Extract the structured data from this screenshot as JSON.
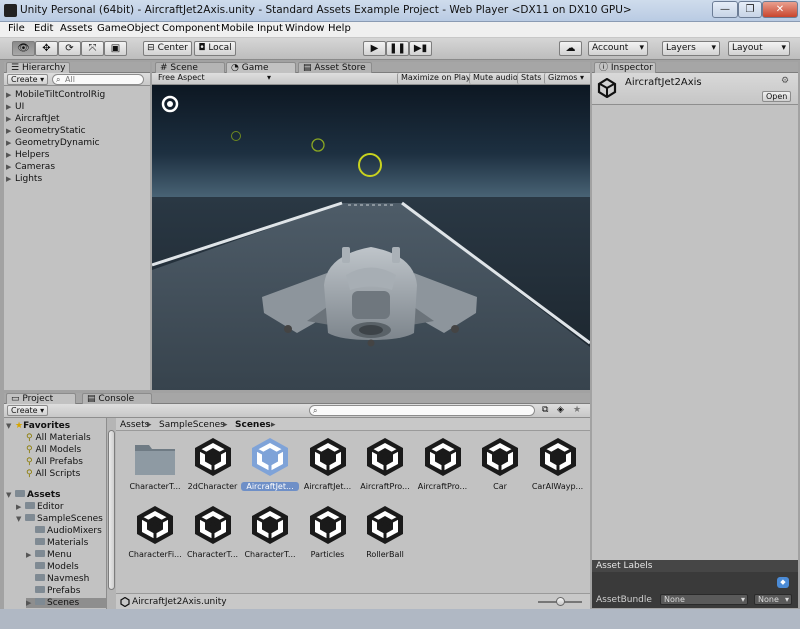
{
  "window": {
    "title": "Unity Personal (64bit) - AircraftJet2Axis.unity - Standard Assets Example Project - Web Player <DX11 on DX10 GPU>",
    "minimize": "—",
    "maximize": "❐",
    "close": "✕"
  },
  "menu": [
    "File",
    "Edit",
    "Assets",
    "GameObject",
    "Component",
    "Mobile Input",
    "Window",
    "Help"
  ],
  "toolbar": {
    "center_label": "Center",
    "local_label": "Local",
    "account_label": "Account",
    "layers_label": "Layers",
    "layout_label": "Layout"
  },
  "hierarchy": {
    "tab": "Hierarchy",
    "create": "Create",
    "search_placeholder": "All",
    "items": [
      "MobileTiltControlRig",
      "UI",
      "AircraftJet",
      "GeometryStatic",
      "GeometryDynamic",
      "Helpers",
      "Cameras",
      "Lights"
    ]
  },
  "center_tabs": {
    "scene": "Scene",
    "game": "Game",
    "asset_store": "Asset Store"
  },
  "game": {
    "aspect": "Free Aspect",
    "maximize_on_play": "Maximize on Play",
    "mute_audio": "Mute audio",
    "stats": "Stats",
    "gizmos": "Gizmos"
  },
  "inspector": {
    "tab": "Inspector",
    "object_name": "AircraftJet2Axis",
    "open_button": "Open",
    "asset_labels": "Asset Labels",
    "asset_bundle": "AssetBundle",
    "bundle_value": "None",
    "variant_value": "None"
  },
  "project": {
    "tab_project": "Project",
    "tab_console": "Console",
    "create": "Create",
    "breadcrumb": [
      "Assets",
      "SampleScenes",
      "Scenes"
    ],
    "favorites": {
      "label": "Favorites",
      "items": [
        "All Materials",
        "All Models",
        "All Prefabs",
        "All Scripts"
      ]
    },
    "tree": {
      "root": "Assets",
      "editor": "Editor",
      "samplescenes": "SampleScenes",
      "children": [
        "AudioMixers",
        "Materials",
        "Menu",
        "Models",
        "Navmesh",
        "Prefabs",
        "Scenes"
      ]
    },
    "assets": [
      {
        "label": "CharacterT...",
        "kind": "folder"
      },
      {
        "label": "2dCharacter",
        "kind": "scene"
      },
      {
        "label": "AircraftJet...",
        "kind": "scene",
        "selected": true
      },
      {
        "label": "AircraftJet...",
        "kind": "scene"
      },
      {
        "label": "AircraftPro...",
        "kind": "scene"
      },
      {
        "label": "AircraftPro...",
        "kind": "scene"
      },
      {
        "label": "Car",
        "kind": "scene"
      },
      {
        "label": "CarAIWayp...",
        "kind": "scene"
      },
      {
        "label": "CharacterFi...",
        "kind": "scene"
      },
      {
        "label": "CharacterT...",
        "kind": "scene"
      },
      {
        "label": "CharacterT...",
        "kind": "scene"
      },
      {
        "label": "Particles",
        "kind": "scene"
      },
      {
        "label": "RollerBall",
        "kind": "scene"
      }
    ],
    "status_file": "AircraftJet2Axis.unity"
  },
  "colors": {
    "selection": "#6e8fc7",
    "panel": "#c2c2c2"
  }
}
